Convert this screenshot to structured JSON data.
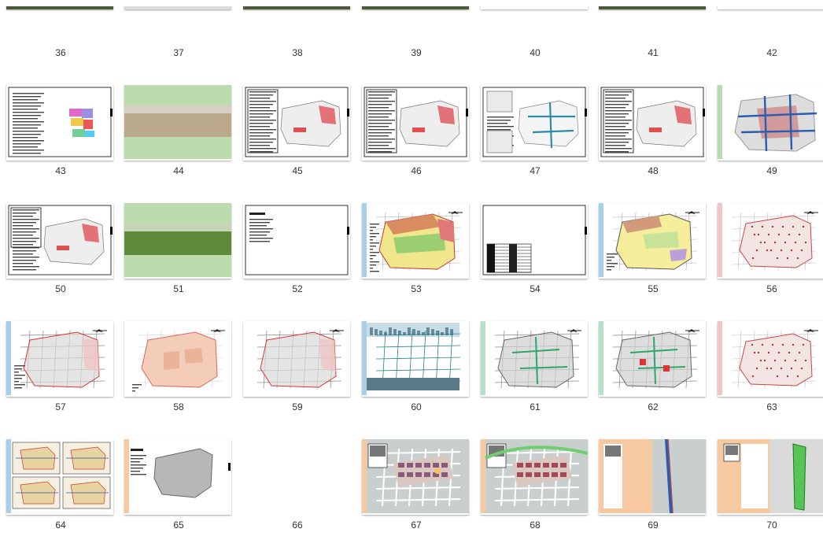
{
  "window": {
    "view": "Large icons"
  },
  "slides": [
    {
      "number": "36",
      "kind": "photo"
    },
    {
      "number": "37",
      "kind": "photo-map"
    },
    {
      "number": "38",
      "kind": "photo"
    },
    {
      "number": "39",
      "kind": "photo"
    },
    {
      "number": "40",
      "kind": "diagram-red"
    },
    {
      "number": "41",
      "kind": "photo"
    },
    {
      "number": "42",
      "kind": "blank"
    },
    {
      "number": "43",
      "kind": "text-diagram"
    },
    {
      "number": "44",
      "kind": "green-photo"
    },
    {
      "number": "45",
      "kind": "text-map-red"
    },
    {
      "number": "46",
      "kind": "text-map-red"
    },
    {
      "number": "47",
      "kind": "text-map-blue"
    },
    {
      "number": "48",
      "kind": "text-map-red"
    },
    {
      "number": "49",
      "kind": "map-blue-red"
    },
    {
      "number": "50",
      "kind": "text-map-red"
    },
    {
      "number": "51",
      "kind": "green-photo"
    },
    {
      "number": "52",
      "kind": "text-list"
    },
    {
      "number": "53",
      "kind": "plan-colored"
    },
    {
      "number": "54",
      "kind": "table"
    },
    {
      "number": "55",
      "kind": "plan-yellow"
    },
    {
      "number": "56",
      "kind": "plan-pink"
    },
    {
      "number": "57",
      "kind": "plan-grey-red"
    },
    {
      "number": "58",
      "kind": "plan-peach"
    },
    {
      "number": "59",
      "kind": "plan-grey-red"
    },
    {
      "number": "60",
      "kind": "plan-skyline"
    },
    {
      "number": "61",
      "kind": "plan-green"
    },
    {
      "number": "62",
      "kind": "plan-green"
    },
    {
      "number": "63",
      "kind": "plan-pink"
    },
    {
      "number": "64",
      "kind": "four-plans"
    },
    {
      "number": "65",
      "kind": "text-plan"
    },
    {
      "number": "66",
      "kind": "none"
    },
    {
      "number": "67",
      "kind": "site-plan"
    },
    {
      "number": "68",
      "kind": "site-plan"
    },
    {
      "number": "69",
      "kind": "strip-plan"
    },
    {
      "number": "70",
      "kind": "strip-plan-green"
    }
  ]
}
